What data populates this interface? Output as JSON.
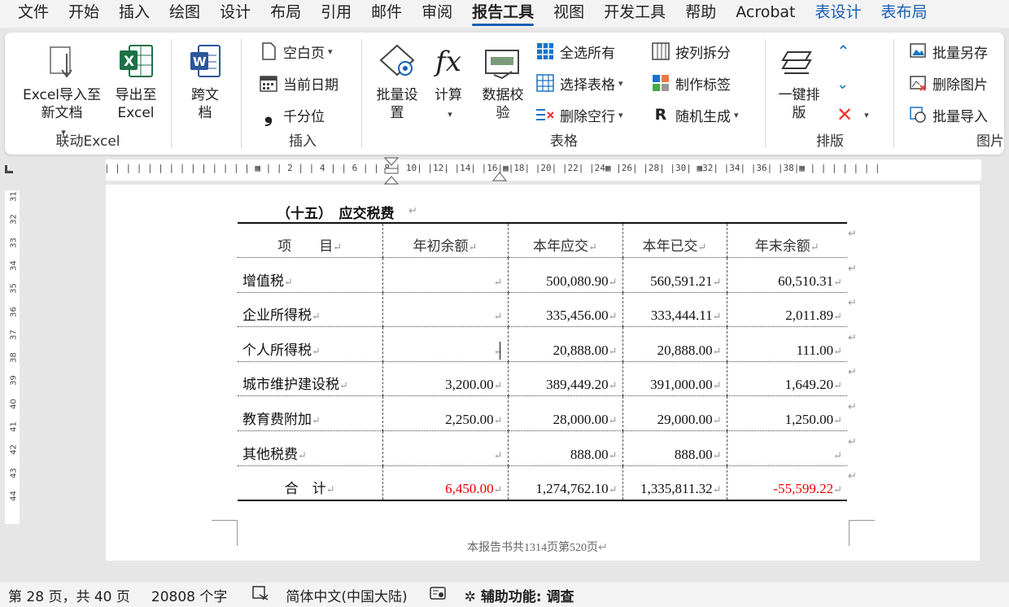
{
  "tabs": [
    "文件",
    "开始",
    "插入",
    "绘图",
    "设计",
    "布局",
    "引用",
    "邮件",
    "审阅",
    "报告工具",
    "视图",
    "开发工具",
    "帮助",
    "Acrobat",
    "表设计",
    "表布局"
  ],
  "ribbon": {
    "group_excel": {
      "label": "联动Excel",
      "import": "Excel导入至新文档",
      "export": "导出至Excel"
    },
    "group_cross": {
      "cross_doc": "跨文档"
    },
    "group_insert": {
      "label": "插入",
      "blank_page": "空白页",
      "current_date": "当前日期",
      "thousands": "千分位"
    },
    "group_table": {
      "label": "表格",
      "batch_set": "批量设置",
      "calc": "计算",
      "verify": "数据校验",
      "select_all": "全选所有",
      "select_table": "选择表格",
      "delete_empty": "删除空行",
      "split_col": "按列拆分",
      "make_label": "制作标签",
      "random_gen": "随机生成"
    },
    "group_layout": {
      "label": "排版",
      "one_click": "一键排版"
    },
    "group_image": {
      "label": "图片",
      "batch_save": "批量另存",
      "delete_image": "删除图片",
      "batch_import": "批量导入"
    }
  },
  "ruler": {
    "numbers": "| | | | | | | | | | | | | | ▦  |  | 2 |  | 4 |  | 6 |  | 8 |  10|  |12|  |14|  |16|▦|18|  |20|  |22|  |24▦ |26|  |28|  |30| ▦32|  |34|  |36|  |38|▦ | | | | | | |"
  },
  "vruler": [
    "31",
    "32",
    "33",
    "34",
    "35",
    "36",
    "37",
    "38",
    "39",
    "40",
    "41",
    "42",
    "43",
    "44"
  ],
  "document": {
    "heading": "（十五）　应交税费",
    "headers": [
      "项　　目",
      "年初余额",
      "本年应交",
      "本年已交",
      "年末余额"
    ],
    "rows": [
      [
        "增值税",
        "",
        "500,080.90",
        "560,591.21",
        "60,510.31"
      ],
      [
        "企业所得税",
        "",
        "335,456.00",
        "333,444.11",
        "2,011.89"
      ],
      [
        "个人所得税",
        "",
        "20,888.00",
        "20,888.00",
        "111.00"
      ],
      [
        "城市维护建设税",
        "3,200.00",
        "389,449.20",
        "391,000.00",
        "1,649.20"
      ],
      [
        "教育费附加",
        "2,250.00",
        "28,000.00",
        "29,000.00",
        "1,250.00"
      ],
      [
        "其他税费",
        "",
        "888.00",
        "888.00",
        ""
      ]
    ],
    "total": [
      "合　计",
      "6,450.00",
      "1,274,762.10",
      "1,335,811.32",
      "-55,599.22"
    ],
    "footer": "本报告书共1314页第520页"
  },
  "status": {
    "page": "第 28 页，共 40 页",
    "words": "20808 个字",
    "language": "简体中文(中国大陆)",
    "accessibility": "辅助功能: 调查"
  },
  "colors": {
    "accent": "#1a5fb4",
    "negative": "#e00000"
  }
}
